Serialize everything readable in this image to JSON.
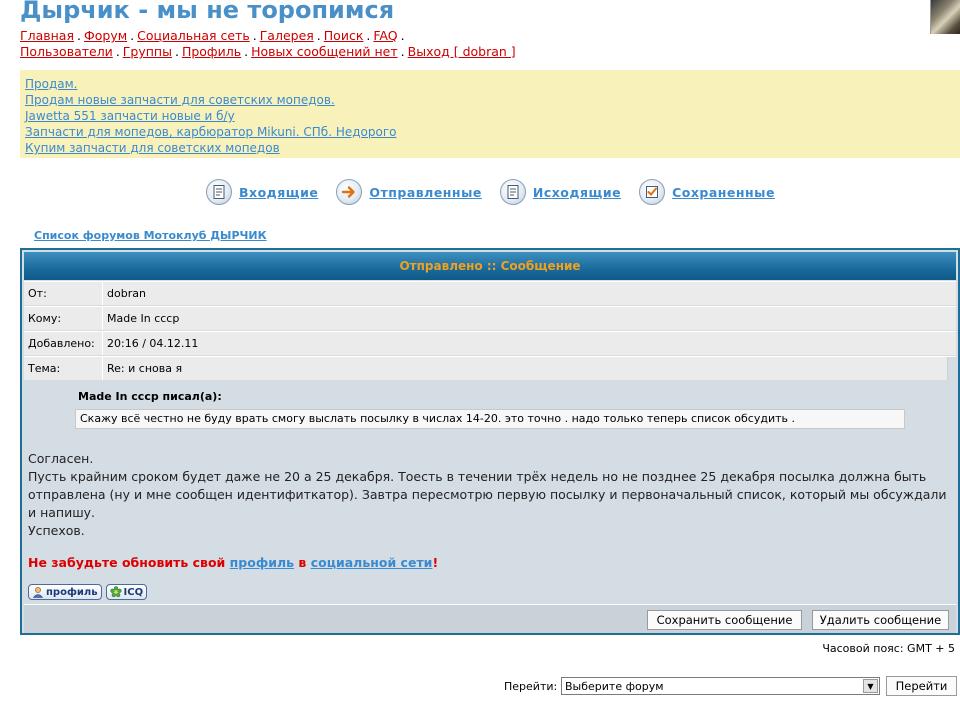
{
  "site": {
    "title": "Дырчик - мы не торопимся"
  },
  "nav": {
    "row1": [
      "Главная",
      "Форум",
      "Социальная сеть",
      "Галерея",
      "Поиск",
      "FAQ"
    ],
    "row2": [
      "Пользователи",
      "Группы",
      "Профиль",
      "Новых сообщений нет",
      "Выход [ dobran ]"
    ]
  },
  "ads": [
    "Продам.",
    "Продам новые запчасти для советских мопедов.",
    "Jawetta 551 запчасти новые и б/у",
    "Запчасти для мопедов, карбюратор Mikuni. СПб. Недорого",
    "Купим запчасти для советских мопедов"
  ],
  "pm_nav": [
    {
      "label": "Входящие",
      "icon": "inbox-icon"
    },
    {
      "label": "Отправленные",
      "icon": "arrow-right-icon"
    },
    {
      "label": "Исходящие",
      "icon": "outbox-icon"
    },
    {
      "label": "Сохраненные",
      "icon": "checkbox-icon"
    }
  ],
  "breadcrumb": "Список форумов Мотоклуб ДЫРЧИК",
  "message": {
    "header": "Отправлено :: Сообщение",
    "from_label": "От:",
    "from": "dobran",
    "to_label": "Кому:",
    "to": "Made In cccp",
    "date_label": "Добавлено:",
    "date": "20:16 / 04.12.11",
    "subject_label": "Тема:",
    "subject": "Re: и снова я",
    "quote_author": "Made In cccp писал(а):",
    "quote": "Скажу всё честно не буду врать смогу выслать посылку в числах 14-20. это точно . надо только теперь список обсудить .",
    "body": [
      "Согласен.",
      "Пусть крайним сроком будет даже не 20 а 25 декабря. Тоесть в течении трёх недель но не позднее 25 декабря посылка должна быть отправлена (ну и мне сообщен идентифиткатор). Завтра пересмотрю первую посылку и первоначальный список, который мы обсуждали и напишу.",
      "Успехов."
    ],
    "reminder_prefix": "Не забудьте обновить свой ",
    "reminder_link1": "профиль",
    "reminder_mid": " в ",
    "reminder_link2": "социальной сети",
    "reminder_suffix": "!",
    "profile_btn": "профиль",
    "icq_btn": "ICQ",
    "save_btn": "Сохранить сообщение",
    "delete_btn": "Удалить сообщение"
  },
  "footer": {
    "timezone": "Часовой пояс: GMT + 5",
    "jump_label": "Перейти:",
    "jump_select": "Выберите форум",
    "jump_btn": "Перейти"
  },
  "colors": {
    "title": "#4a90c8",
    "link_red": "#cc0000",
    "link_blue": "#3a8ad0",
    "header_text": "#f0a020",
    "header_bg": "#1a6a9c",
    "ad_bg": "#f9f1ba"
  }
}
